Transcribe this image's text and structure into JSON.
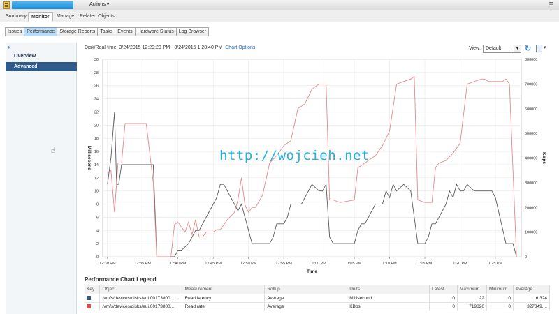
{
  "topbar": {
    "actions_label": "Actions",
    "object_icon": "datastore-icon"
  },
  "tabs": [
    {
      "label": "Summary",
      "active": false
    },
    {
      "label": "Monitor",
      "active": true
    },
    {
      "label": "Manage",
      "active": false
    },
    {
      "label": "Related Objects",
      "active": false
    }
  ],
  "subtabs": [
    {
      "label": "Issues",
      "active": false
    },
    {
      "label": "Performance",
      "active": true
    },
    {
      "label": "Storage Reports",
      "active": false
    },
    {
      "label": "Tasks",
      "active": false
    },
    {
      "label": "Events",
      "active": false
    },
    {
      "label": "Hardware Status",
      "active": false
    },
    {
      "label": "Log Browser",
      "active": false
    }
  ],
  "left_nav": {
    "collapse_glyph": "«",
    "items": [
      {
        "label": "Overview",
        "active": false
      },
      {
        "label": "Advanced",
        "active": true
      }
    ]
  },
  "chart_header": {
    "title": "Disk/Real-time, 3/24/2015 12:29:20 PM - 3/24/2015 1:28:40 PM",
    "options_link": "Chart Options"
  },
  "view": {
    "label": "View:",
    "selected": "Default"
  },
  "watermark": "http://wojcieh.net",
  "chart_data": {
    "type": "line",
    "xlabel": "Time",
    "ylabel_left": "Millisecond",
    "ylabel_right": "KBps",
    "x_ticks": [
      "12:30 PM",
      "12:35 PM",
      "12:40 PM",
      "12:45 PM",
      "12:50 PM",
      "12:55 PM",
      "1:00 PM",
      "1:05 PM",
      "1:10 PM",
      "1:15 PM",
      "1:20 PM",
      "1:25 PM"
    ],
    "x_range_minutes": [
      -0.67,
      58.67
    ],
    "ylim_left": [
      0,
      30
    ],
    "ylim_right": [
      0,
      800000
    ],
    "y_ticks_left": [
      "0",
      "2",
      "4",
      "6",
      "8",
      "10",
      "12",
      "14",
      "16",
      "18",
      "20",
      "22",
      "24",
      "26",
      "28",
      "30"
    ],
    "y_ticks_right": [
      "0",
      "100000",
      "200000",
      "300000",
      "400000",
      "500000",
      "600000",
      "700000",
      "800000"
    ],
    "grid": true,
    "series": [
      {
        "name": "Read latency",
        "axis": "left",
        "color": "#595959",
        "x": [
          0,
          0.5,
          1,
          1.3,
          1.6,
          2,
          2.2,
          2.8,
          3,
          5,
          6.5,
          7,
          7.2,
          9.5,
          10,
          10.5,
          11.5,
          12,
          12.5,
          13,
          13.5,
          14,
          15,
          15.5,
          16,
          16.5,
          17,
          17.5,
          18,
          18.5,
          19,
          19.5,
          20,
          20.5,
          21,
          23,
          23.5,
          24,
          24.5,
          25,
          25.5,
          26,
          27,
          27.5,
          28,
          29,
          30,
          30.5,
          31,
          31.5,
          32,
          33,
          35,
          35.5,
          36,
          36.5,
          37,
          38,
          39,
          39.5,
          40,
          40.5,
          41,
          42,
          43,
          44,
          44.5,
          45,
          45.5,
          46,
          46.5,
          47,
          48,
          48.5,
          49,
          49.5,
          50,
          50.5,
          51,
          52,
          52.5,
          53,
          54,
          54.5,
          55,
          56.5,
          57,
          57.5,
          58
        ],
        "y": [
          11,
          15,
          22,
          11,
          11,
          14,
          14,
          14,
          14,
          14,
          14,
          0,
          0,
          0,
          1,
          1,
          2,
          3,
          4,
          4,
          5,
          6,
          8,
          9,
          11,
          11,
          10,
          9,
          8,
          7,
          8,
          6,
          4,
          2,
          2,
          2,
          3,
          5,
          5,
          5,
          6,
          8,
          8,
          8,
          9,
          11,
          10,
          10,
          11,
          3,
          2,
          2,
          2,
          4,
          5,
          5,
          6,
          8,
          8,
          10,
          9,
          11,
          10,
          11,
          10,
          2,
          2,
          2,
          3,
          5,
          5,
          6,
          8,
          10,
          9,
          11,
          10,
          10,
          11,
          10,
          10,
          10,
          10,
          10,
          9,
          2,
          2,
          2,
          0
        ],
        "note_points": "approximate"
      },
      {
        "name": "Read rate",
        "axis": "right",
        "color": "#e28a8a",
        "x": [
          0,
          0.5,
          1,
          1.5,
          2,
          2.5,
          3,
          3.5,
          5,
          5.5,
          6,
          6.5,
          7,
          7.5,
          9,
          9.5,
          10,
          11,
          11.5,
          12,
          12.5,
          13,
          13.5,
          14,
          15,
          15.5,
          16,
          17,
          18,
          18.5,
          19,
          19.5,
          20,
          20.5,
          21,
          22,
          23,
          24,
          25,
          26,
          27,
          28,
          29,
          30,
          30.5,
          31,
          31.5,
          32,
          33,
          35,
          35.5,
          36,
          37,
          38,
          39,
          40,
          41,
          42,
          43,
          43.5,
          44,
          45,
          46,
          46.5,
          47,
          48,
          49,
          50,
          51,
          52,
          53,
          53.5,
          54,
          55,
          56,
          56.5,
          57,
          58
        ],
        "y": [
          340000,
          350000,
          180000,
          380000,
          380000,
          540000,
          540000,
          540000,
          540000,
          540000,
          420000,
          300000,
          0,
          0,
          0,
          130000,
          140000,
          100000,
          140000,
          90000,
          150000,
          80000,
          80000,
          100000,
          100000,
          110000,
          110000,
          150000,
          180000,
          230000,
          320000,
          210000,
          180000,
          200000,
          200000,
          250000,
          380000,
          410000,
          450000,
          470000,
          600000,
          620000,
          680000,
          700000,
          700000,
          700000,
          230000,
          230000,
          220000,
          230000,
          360000,
          370000,
          390000,
          410000,
          450000,
          510000,
          700000,
          710000,
          720000,
          730000,
          230000,
          220000,
          220000,
          360000,
          380000,
          390000,
          420000,
          460000,
          700000,
          710000,
          720000,
          720000,
          710000,
          710000,
          710000,
          720000,
          700000,
          0
        ]
      }
    ]
  },
  "legend": {
    "title": "Performance Chart Legend",
    "columns": [
      "Key",
      "Object",
      "Measurement",
      "Rollup",
      "Units",
      "Latest",
      "Maximum",
      "Minimum",
      "Average"
    ],
    "rows": [
      {
        "key_color": "#3c5a78",
        "object": "/vmfs/devices/disks/eui.00173800...",
        "measurement": "Read latency",
        "rollup": "Average",
        "units": "Millisecond",
        "latest": "0",
        "maximum": "22",
        "minimum": "0",
        "average": "6.324"
      },
      {
        "key_color": "#d64f4f",
        "object": "/vmfs/devices/disks/eui.00173800...",
        "measurement": "Read rate",
        "rollup": "Average",
        "units": "KBps",
        "latest": "0",
        "maximum": "719820",
        "minimum": "0",
        "average": "327349...."
      }
    ]
  }
}
